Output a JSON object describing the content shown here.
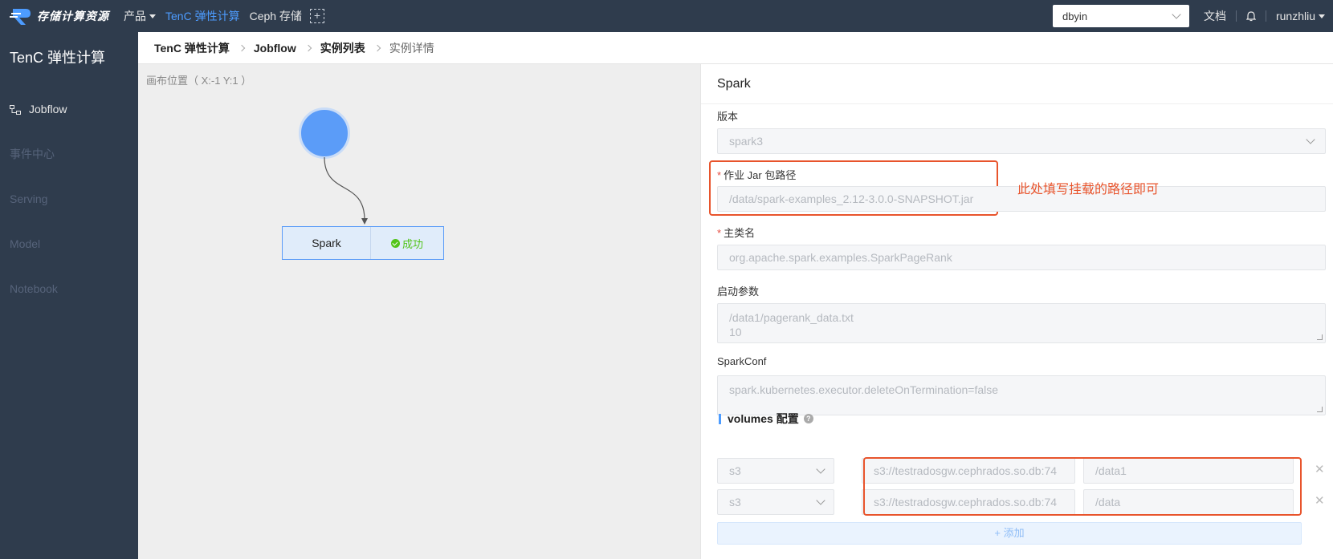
{
  "topbar": {
    "logo_text": "存储计算资源",
    "nav": [
      {
        "label": "产品"
      },
      {
        "label": "TenC 弹性计算"
      },
      {
        "label": "Ceph 存储"
      }
    ],
    "plus_label": "+",
    "namespace": "dbyin",
    "docs_label": "文档",
    "user": "runzhliu"
  },
  "sidebar": {
    "title": "TenC 弹性计算",
    "items": [
      {
        "label": "Jobflow"
      },
      {
        "label": "事件中心"
      },
      {
        "label": "Serving"
      },
      {
        "label": "Model"
      },
      {
        "label": "Notebook"
      }
    ]
  },
  "breadcrumb": [
    "TenC 弹性计算",
    "Jobflow",
    "实例列表",
    "实例详情"
  ],
  "canvas": {
    "position_text": "画布位置（ X:-1   Y:1  ）",
    "node_name": "Spark",
    "node_status": "成功"
  },
  "panel": {
    "title": "Spark",
    "version_label": "版本",
    "version_value": "spark3",
    "jar_label": "作业 Jar 包路径",
    "jar_value": "/data/spark-examples_2.12-3.0.0-SNAPSHOT.jar",
    "annotation": "此处填写挂载的路径即可",
    "main_class_label": "主类名",
    "main_class_value": "org.apache.spark.examples.SparkPageRank",
    "args_label": "启动参数",
    "args_lines": [
      "/data1/pagerank_data.txt",
      "10"
    ],
    "conf_label": "SparkConf",
    "conf_value": "spark.kubernetes.executor.deleteOnTermination=false",
    "volumes_title": "volumes 配置",
    "volumes": [
      {
        "type": "s3",
        "source": "s3://testradosgw.cephrados.so.db:74",
        "target": "/data1"
      },
      {
        "type": "s3",
        "source": "s3://testradosgw.cephrados.so.db:74",
        "target": "/data"
      }
    ],
    "add_label": "+ 添加"
  },
  "colors": {
    "accent": "#4d9cff",
    "annotation": "#e8542c",
    "success": "#52c41a",
    "nav_bg": "#2f3c4d"
  }
}
